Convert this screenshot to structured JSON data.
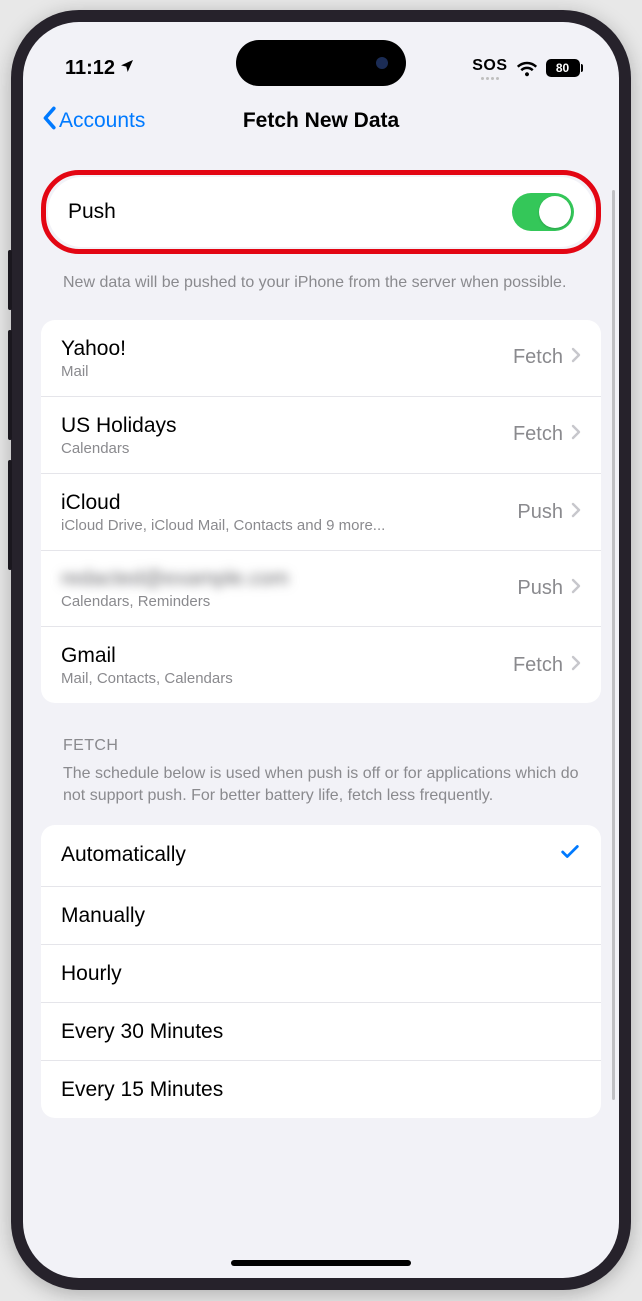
{
  "status": {
    "time": "11:12",
    "sos": "SOS",
    "battery_pct": "80"
  },
  "nav": {
    "back": "Accounts",
    "title": "Fetch New Data"
  },
  "push": {
    "label": "Push",
    "enabled": true,
    "footer": "New data will be pushed to your iPhone from the server when possible."
  },
  "accounts": [
    {
      "name": "Yahoo!",
      "sub": "Mail",
      "mode": "Fetch",
      "blurred": false
    },
    {
      "name": "US Holidays",
      "sub": "Calendars",
      "mode": "Fetch",
      "blurred": false
    },
    {
      "name": "iCloud",
      "sub": "iCloud Drive, iCloud Mail, Contacts and 9 more...",
      "mode": "Push",
      "blurred": false
    },
    {
      "name": "redacted@example.com",
      "sub": "Calendars, Reminders",
      "mode": "Push",
      "blurred": true
    },
    {
      "name": "Gmail",
      "sub": "Mail, Contacts, Calendars",
      "mode": "Fetch",
      "blurred": false
    }
  ],
  "fetch": {
    "header": "FETCH",
    "footer": "The schedule below is used when push is off or for applications which do not support push. For better battery life, fetch less frequently.",
    "options": [
      {
        "label": "Automatically",
        "selected": true
      },
      {
        "label": "Manually",
        "selected": false
      },
      {
        "label": "Hourly",
        "selected": false
      },
      {
        "label": "Every 30 Minutes",
        "selected": false
      },
      {
        "label": "Every 15 Minutes",
        "selected": false
      }
    ]
  }
}
